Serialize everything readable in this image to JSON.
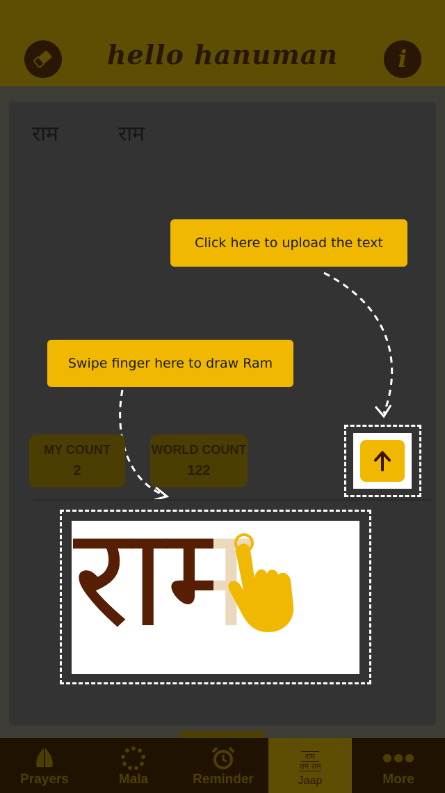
{
  "header": {
    "title": "hello hanuman",
    "left_icon": "eraser-icon",
    "right_icon": "info-icon",
    "right_glyph": "i"
  },
  "written": {
    "entries": [
      "राम",
      "राम"
    ]
  },
  "tips": {
    "upload": "Click here to upload the text",
    "draw": "Swipe finger here to draw Ram"
  },
  "counts": {
    "my_label": "MY COUNT",
    "my_value": "2",
    "world_label": "WORLD COUNT",
    "world_value": "122"
  },
  "canvas": {
    "ghost_text": "राम",
    "drawn_text": "राम",
    "icons": [
      "upload-arrow-icon",
      "hand-pointer-icon"
    ]
  },
  "tabs": [
    {
      "label": "Prayers",
      "icon": "folded-hands-icon"
    },
    {
      "label": "Mala",
      "icon": "mala-beads-icon"
    },
    {
      "label": "Reminder",
      "icon": "alarm-clock-icon"
    },
    {
      "label": "Jaap",
      "icon": "ram-text-icon",
      "active": true,
      "icon_text": "राम",
      "icon_text2": "राम राम"
    },
    {
      "label": "More",
      "icon": "more-dots-icon"
    }
  ],
  "colors": {
    "accent": "#f0b800",
    "header": "#5e4e03",
    "ink": "#561e05",
    "ghost": "#ead9bd"
  }
}
